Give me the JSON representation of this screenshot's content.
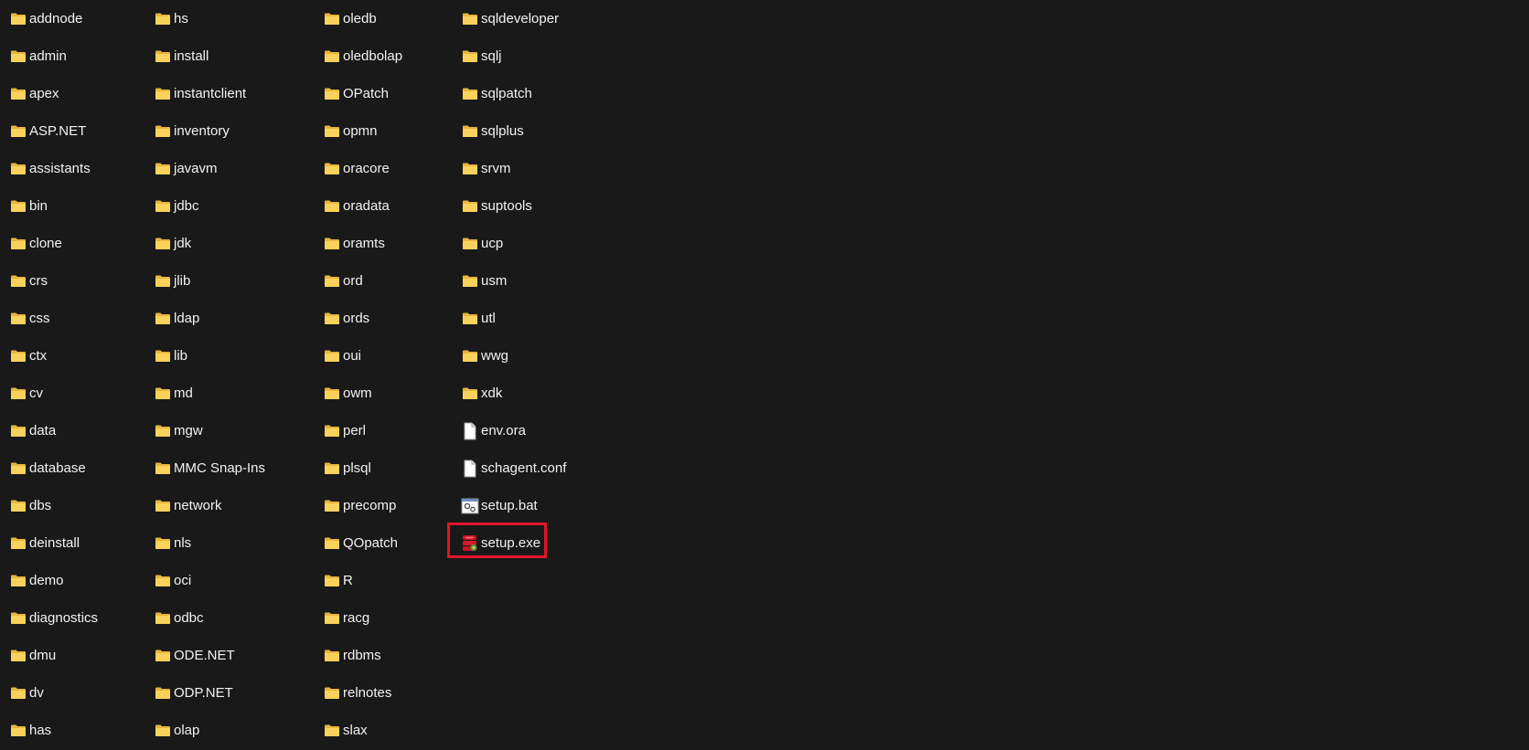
{
  "columns": [
    {
      "items": [
        {
          "name": "addnode",
          "type": "folder"
        },
        {
          "name": "admin",
          "type": "folder"
        },
        {
          "name": "apex",
          "type": "folder"
        },
        {
          "name": "ASP.NET",
          "type": "folder"
        },
        {
          "name": "assistants",
          "type": "folder"
        },
        {
          "name": "bin",
          "type": "folder"
        },
        {
          "name": "clone",
          "type": "folder"
        },
        {
          "name": "crs",
          "type": "folder"
        },
        {
          "name": "css",
          "type": "folder"
        },
        {
          "name": "ctx",
          "type": "folder"
        },
        {
          "name": "cv",
          "type": "folder"
        },
        {
          "name": "data",
          "type": "folder"
        },
        {
          "name": "database",
          "type": "folder"
        },
        {
          "name": "dbs",
          "type": "folder"
        },
        {
          "name": "deinstall",
          "type": "folder"
        },
        {
          "name": "demo",
          "type": "folder"
        },
        {
          "name": "diagnostics",
          "type": "folder"
        },
        {
          "name": "dmu",
          "type": "folder"
        },
        {
          "name": "dv",
          "type": "folder"
        },
        {
          "name": "has",
          "type": "folder"
        }
      ]
    },
    {
      "items": [
        {
          "name": "hs",
          "type": "folder"
        },
        {
          "name": "install",
          "type": "folder"
        },
        {
          "name": "instantclient",
          "type": "folder"
        },
        {
          "name": "inventory",
          "type": "folder"
        },
        {
          "name": "javavm",
          "type": "folder"
        },
        {
          "name": "jdbc",
          "type": "folder"
        },
        {
          "name": "jdk",
          "type": "folder"
        },
        {
          "name": "jlib",
          "type": "folder"
        },
        {
          "name": "ldap",
          "type": "folder"
        },
        {
          "name": "lib",
          "type": "folder"
        },
        {
          "name": "md",
          "type": "folder"
        },
        {
          "name": "mgw",
          "type": "folder"
        },
        {
          "name": "MMC Snap-Ins",
          "type": "folder"
        },
        {
          "name": "network",
          "type": "folder"
        },
        {
          "name": "nls",
          "type": "folder"
        },
        {
          "name": "oci",
          "type": "folder"
        },
        {
          "name": "odbc",
          "type": "folder"
        },
        {
          "name": "ODE.NET",
          "type": "folder"
        },
        {
          "name": "ODP.NET",
          "type": "folder"
        },
        {
          "name": "olap",
          "type": "folder"
        }
      ]
    },
    {
      "items": [
        {
          "name": "oledb",
          "type": "folder"
        },
        {
          "name": "oledbolap",
          "type": "folder"
        },
        {
          "name": "OPatch",
          "type": "folder"
        },
        {
          "name": "opmn",
          "type": "folder"
        },
        {
          "name": "oracore",
          "type": "folder"
        },
        {
          "name": "oradata",
          "type": "folder"
        },
        {
          "name": "oramts",
          "type": "folder"
        },
        {
          "name": "ord",
          "type": "folder"
        },
        {
          "name": "ords",
          "type": "folder"
        },
        {
          "name": "oui",
          "type": "folder"
        },
        {
          "name": "owm",
          "type": "folder"
        },
        {
          "name": "perl",
          "type": "folder"
        },
        {
          "name": "plsql",
          "type": "folder"
        },
        {
          "name": "precomp",
          "type": "folder"
        },
        {
          "name": "QOpatch",
          "type": "folder"
        },
        {
          "name": "R",
          "type": "folder"
        },
        {
          "name": "racg",
          "type": "folder"
        },
        {
          "name": "rdbms",
          "type": "folder"
        },
        {
          "name": "relnotes",
          "type": "folder"
        },
        {
          "name": "slax",
          "type": "folder"
        }
      ]
    },
    {
      "items": [
        {
          "name": "sqldeveloper",
          "type": "folder"
        },
        {
          "name": "sqlj",
          "type": "folder"
        },
        {
          "name": "sqlpatch",
          "type": "folder"
        },
        {
          "name": "sqlplus",
          "type": "folder"
        },
        {
          "name": "srvm",
          "type": "folder"
        },
        {
          "name": "suptools",
          "type": "folder"
        },
        {
          "name": "ucp",
          "type": "folder"
        },
        {
          "name": "usm",
          "type": "folder"
        },
        {
          "name": "utl",
          "type": "folder"
        },
        {
          "name": "wwg",
          "type": "folder"
        },
        {
          "name": "xdk",
          "type": "folder"
        },
        {
          "name": "env.ora",
          "type": "file"
        },
        {
          "name": "schagent.conf",
          "type": "file"
        },
        {
          "name": "setup.bat",
          "type": "batch"
        },
        {
          "name": "setup.exe",
          "type": "exe",
          "highlighted": true
        }
      ]
    }
  ],
  "colors": {
    "background": "#191919",
    "text": "#f2f2f2",
    "folder": "#f5c94a",
    "highlight": "#e0162b"
  },
  "icons": {
    "folder": "folder-icon",
    "file": "file-icon",
    "batch": "batch-file-icon",
    "exe": "installer-icon"
  }
}
